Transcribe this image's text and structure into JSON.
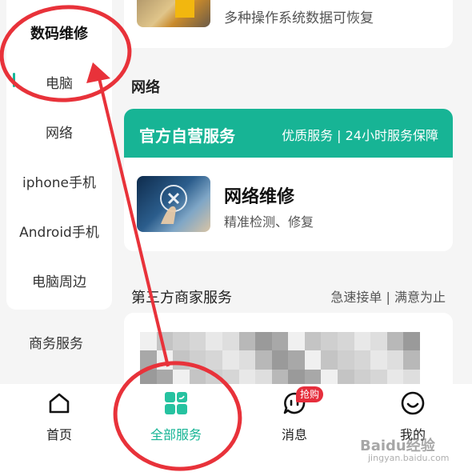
{
  "sidebar": {
    "category": "数码维修",
    "items": [
      {
        "label": "电脑",
        "active": true
      },
      {
        "label": "网络"
      },
      {
        "label": "iphone手机"
      },
      {
        "label": "Android手机"
      },
      {
        "label": "电脑周边"
      }
    ],
    "next_category": "商务服务"
  },
  "main": {
    "top_card_desc": "多种操作系统数据可恢复",
    "section_title": "网络",
    "official": {
      "title": "官方自营服务",
      "subtitle": "优质服务 | 24小时服务保障",
      "service_name": "网络维修",
      "service_desc": "精准检测、修复"
    },
    "third_party": {
      "title": "第三方商家服务",
      "subtitle": "急速接单 | 满意为止"
    }
  },
  "bottom_nav": {
    "items": [
      {
        "label": "首页",
        "icon": "home-icon"
      },
      {
        "label": "全部服务",
        "icon": "grid-icon",
        "active": true
      },
      {
        "label": "消息",
        "icon": "message-icon",
        "badge": "抢购"
      },
      {
        "label": "我的",
        "icon": "smile-icon"
      }
    ]
  },
  "colors": {
    "accent": "#17b495",
    "annotation": "#e8323a",
    "badge": "#e62e3c"
  },
  "watermark": {
    "brand": "Baidu经验",
    "url": "jingyan.baidu.com"
  }
}
